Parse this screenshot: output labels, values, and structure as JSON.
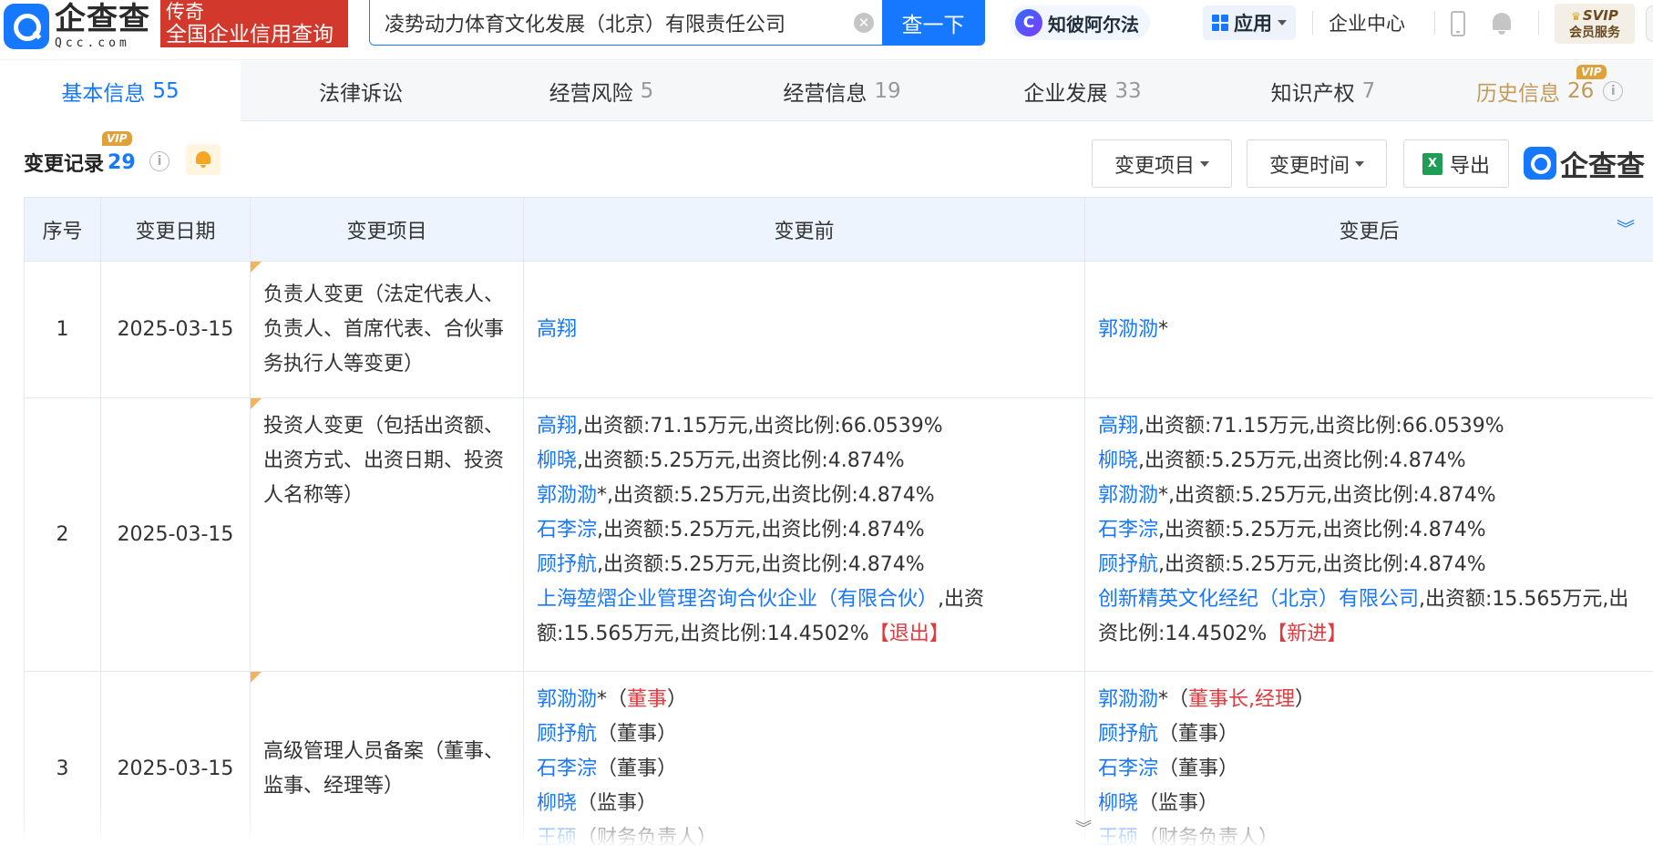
{
  "header": {
    "logo_cn": "企查查",
    "logo_en": "Qcc.com",
    "promo_line1": "传奇",
    "promo_line2": "全国企业信用查询",
    "search_value": "凌势动力体育文化发展（北京）有限责任公司",
    "search_button": "查一下",
    "ai_label": "知彼阿尔法",
    "apps_label": "应用",
    "enterprise_center": "企业中心",
    "svip_line1": "SVIP",
    "svip_line2": "会员服务"
  },
  "tabs": [
    {
      "label": "基本信息",
      "count": "55"
    },
    {
      "label": "法律诉讼",
      "count": ""
    },
    {
      "label": "经营风险",
      "count": "5"
    },
    {
      "label": "经营信息",
      "count": "19"
    },
    {
      "label": "企业发展",
      "count": "33"
    },
    {
      "label": "知识产权",
      "count": "7"
    },
    {
      "label": "历史信息",
      "count": "26"
    }
  ],
  "vip_badge": "VIP",
  "section": {
    "title": "变更记录",
    "count": "29",
    "filter_item": "变更项目",
    "filter_time": "变更时间",
    "export": "导出",
    "watermark": "企查查"
  },
  "table": {
    "headers": {
      "no": "序号",
      "date": "变更日期",
      "item": "变更项目",
      "before": "变更前",
      "after": "变更后"
    },
    "rows": [
      {
        "no": "1",
        "date": "2025-03-15",
        "item": "负责人变更（法定代表人、负责人、首席代表、合伙事务执行人等变更）",
        "before": [
          {
            "name": "高翔",
            "rest": ""
          }
        ],
        "after": [
          {
            "name": "郭泐泐",
            "rest": "*"
          }
        ]
      },
      {
        "no": "2",
        "date": "2025-03-15",
        "item": "投资人变更（包括出资额、出资方式、出资日期、投资人名称等）",
        "before": [
          {
            "name": "高翔",
            "rest": ",出资额:71.15万元,出资比例:66.0539%"
          },
          {
            "name": "柳晓",
            "rest": ",出资额:5.25万元,出资比例:4.874%"
          },
          {
            "name": "郭泐泐",
            "rest": "*,出资额:5.25万元,出资比例:4.874%"
          },
          {
            "name": "石李淙",
            "rest": ",出资额:5.25万元,出资比例:4.874%"
          },
          {
            "name": "顾抒航",
            "rest": ",出资额:5.25万元,出资比例:4.874%"
          },
          {
            "name": "上海堃熠企业管理咨询合伙企业（有限合伙）",
            "rest": ",出资额:15.565万元,出资比例:14.4502%",
            "tag": "【退出】"
          }
        ],
        "after": [
          {
            "name": "高翔",
            "rest": ",出资额:71.15万元,出资比例:66.0539%"
          },
          {
            "name": "柳晓",
            "rest": ",出资额:5.25万元,出资比例:4.874%"
          },
          {
            "name": "郭泐泐",
            "rest": "*,出资额:5.25万元,出资比例:4.874%"
          },
          {
            "name": "石李淙",
            "rest": ",出资额:5.25万元,出资比例:4.874%"
          },
          {
            "name": "顾抒航",
            "rest": ",出资额:5.25万元,出资比例:4.874%"
          },
          {
            "name": "创新精英文化经纪（北京）有限公司",
            "rest": ",出资额:15.565万元,出资比例:14.4502%",
            "tag": "【新进】"
          }
        ]
      },
      {
        "no": "3",
        "date": "2025-03-15",
        "item": "高级管理人员备案（董事、监事、经理等）",
        "before": [
          {
            "name": "郭泐泐",
            "star": "*",
            "open": "（",
            "role": "董事",
            "close": "）",
            "role_red": true
          },
          {
            "name": "顾抒航",
            "star": "",
            "open": "（",
            "role": "董事",
            "close": "）",
            "role_red": false
          },
          {
            "name": "石李淙",
            "star": "",
            "open": "（",
            "role": "董事",
            "close": "）",
            "role_red": false
          },
          {
            "name": "柳晓",
            "star": "",
            "open": "（",
            "role": "监事",
            "close": "）",
            "role_red": false
          },
          {
            "name": "王硕",
            "star": "",
            "open": "（",
            "role": "财务负责人",
            "close": "）",
            "role_red": false
          }
        ],
        "after": [
          {
            "name": "郭泐泐",
            "star": "*",
            "open": "（",
            "role": "董事长,经理",
            "close": "）",
            "role_red": true
          },
          {
            "name": "顾抒航",
            "star": "",
            "open": "（",
            "role": "董事",
            "close": "）",
            "role_red": false
          },
          {
            "name": "石李淙",
            "star": "",
            "open": "（",
            "role": "董事",
            "close": "）",
            "role_red": false
          },
          {
            "name": "柳晓",
            "star": "",
            "open": "（",
            "role": "监事",
            "close": "）",
            "role_red": false
          },
          {
            "name": "王硕",
            "star": "",
            "open": "（",
            "role": "财务负责人",
            "close": "）",
            "role_red": false
          }
        ]
      }
    ]
  },
  "colors": {
    "accent": "#1677ff",
    "brand_red": "#d3382c",
    "alert_red": "#e0393e",
    "vip_gold": "#c29a5a"
  }
}
